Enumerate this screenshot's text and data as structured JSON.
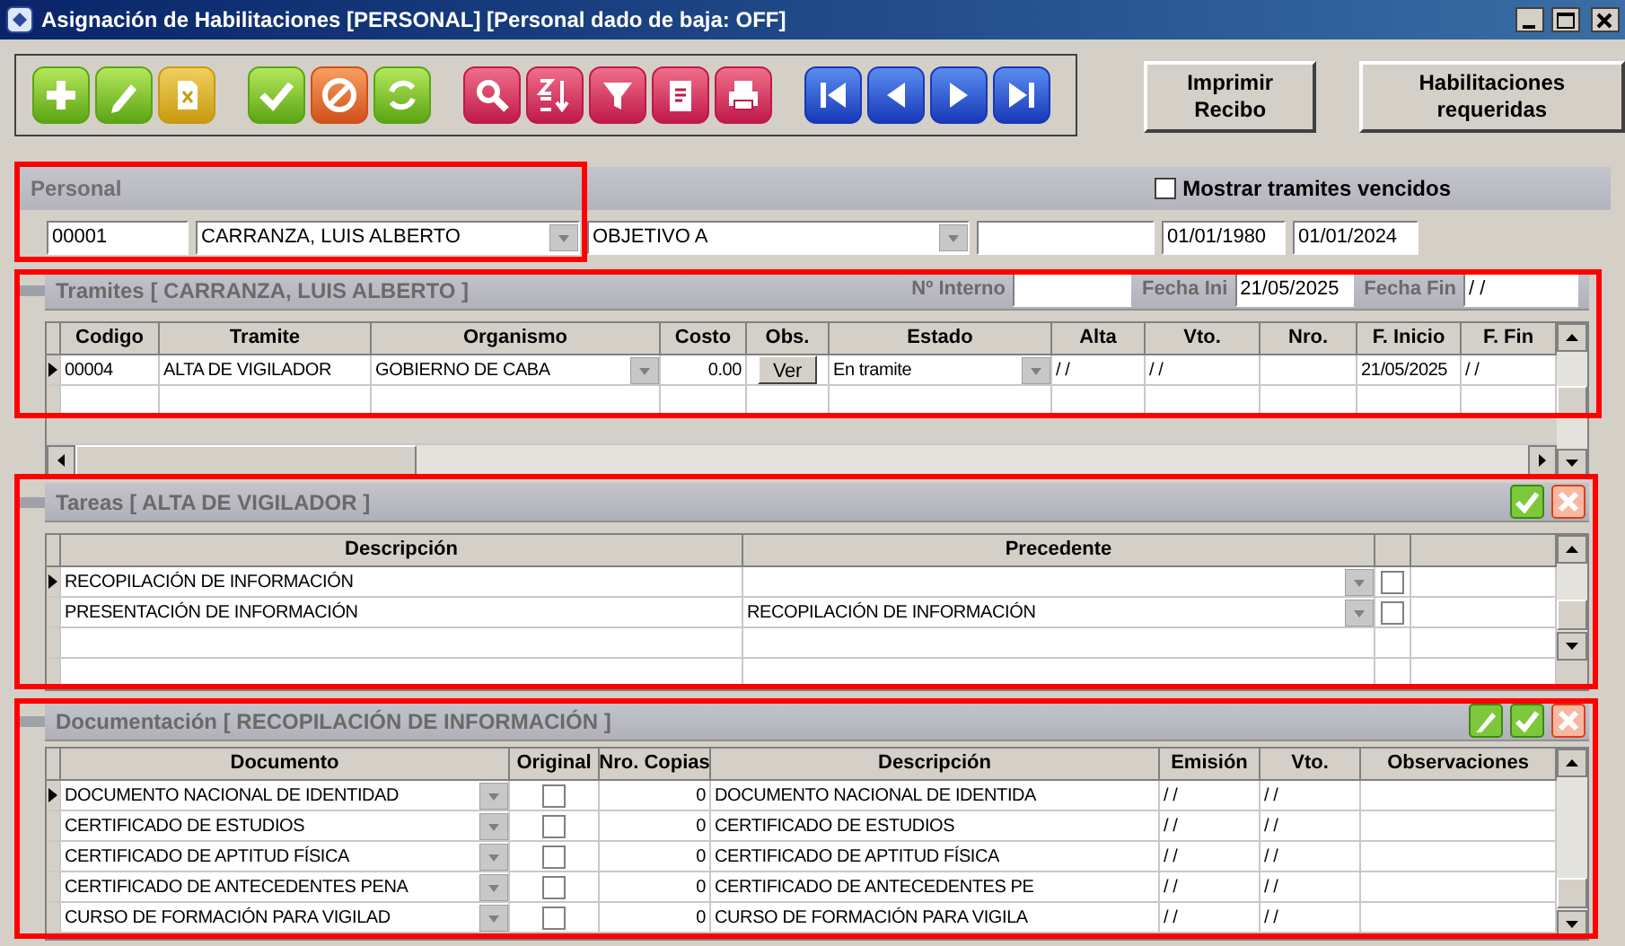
{
  "window": {
    "title": "Asignación de Habilitaciones [PERSONAL] [Personal dado de baja: OFF]"
  },
  "action_buttons": [
    "Imprimir Recibo",
    "Habilitaciones requeridas"
  ],
  "personal": {
    "title": "Personal",
    "show_expired": {
      "label": "Mostrar tramites vencidos",
      "checked": false
    },
    "code": "00001",
    "name": "CARRANZA, LUIS ALBERTO",
    "objective": "OBJETIVO A",
    "date_from": "01/01/1980",
    "date_to": "01/01/2024"
  },
  "tramites": {
    "title": "Tramites [ CARRANZA, LUIS ALBERTO ]",
    "interno_label": "Nº Interno",
    "fecha_ini_label": "Fecha Ini",
    "fecha_ini": "21/05/2025",
    "fecha_fin_label": "Fecha Fin",
    "fecha_fin": "/ /",
    "columns": [
      "Codigo",
      "Tramite",
      "Organismo",
      "Costo",
      "Obs.",
      "Estado",
      "Alta",
      "Vto.",
      "Nro.",
      "F. Inicio",
      "F. Fin"
    ],
    "rows": [
      {
        "current": true,
        "codigo": "00004",
        "tramite": "ALTA DE VIGILADOR",
        "organismo": "GOBIERNO DE CABA",
        "costo": "0.00",
        "obs": "Ver",
        "estado": "En tramite",
        "alta": "/ /",
        "vto": "/ /",
        "f_inicio": "21/05/2025",
        "f_fin": "/ /"
      }
    ]
  },
  "tareas": {
    "title": "Tareas [ ALTA DE VIGILADOR ]",
    "columns": [
      "Descripción",
      "Precedente"
    ],
    "rows": [
      {
        "current": true,
        "descripcion": "RECOPILACIÓN DE INFORMACIÓN",
        "checked": false
      },
      {
        "current": false,
        "descripcion": "PRESENTACIÓN DE INFORMACIÓN",
        "precedente": "RECOPILACIÓN DE INFORMACIÓN",
        "checked": false
      }
    ]
  },
  "documentacion": {
    "title": "Documentación [ RECOPILACIÓN DE INFORMACIÓN ]",
    "columns": [
      "Documento",
      "Original",
      "Nro. Copias",
      "Descripción",
      "Emisión",
      "Vto.",
      "Observaciones"
    ],
    "rows": [
      {
        "current": true,
        "documento": "DOCUMENTO NACIONAL DE IDENTIDAD",
        "original": false,
        "copias": "0",
        "descripcion": "DOCUMENTO NACIONAL DE IDENTIDA",
        "emision": "/ /",
        "vto": "/ /"
      },
      {
        "current": false,
        "documento": "CERTIFICADO DE ESTUDIOS",
        "original": false,
        "copias": "0",
        "descripcion": "CERTIFICADO DE ESTUDIOS",
        "emision": "/ /",
        "vto": "/ /"
      },
      {
        "current": false,
        "documento": "CERTIFICADO DE APTITUD FÍSICA",
        "original": false,
        "copias": "0",
        "descripcion": "CERTIFICADO DE APTITUD FÍSICA",
        "emision": "/ /",
        "vto": "/ /"
      },
      {
        "current": false,
        "documento": "CERTIFICADO DE ANTECEDENTES PENA",
        "original": false,
        "copias": "0",
        "descripcion": "CERTIFICADO DE ANTECEDENTES PE",
        "emision": "/ /",
        "vto": "/ /"
      },
      {
        "current": false,
        "documento": "CURSO DE FORMACIÓN PARA VIGILAD",
        "original": false,
        "copias": "0",
        "descripcion": "CURSO DE FORMACIÓN PARA VIGILA",
        "emision": "/ /",
        "vto": "/ /"
      }
    ]
  }
}
